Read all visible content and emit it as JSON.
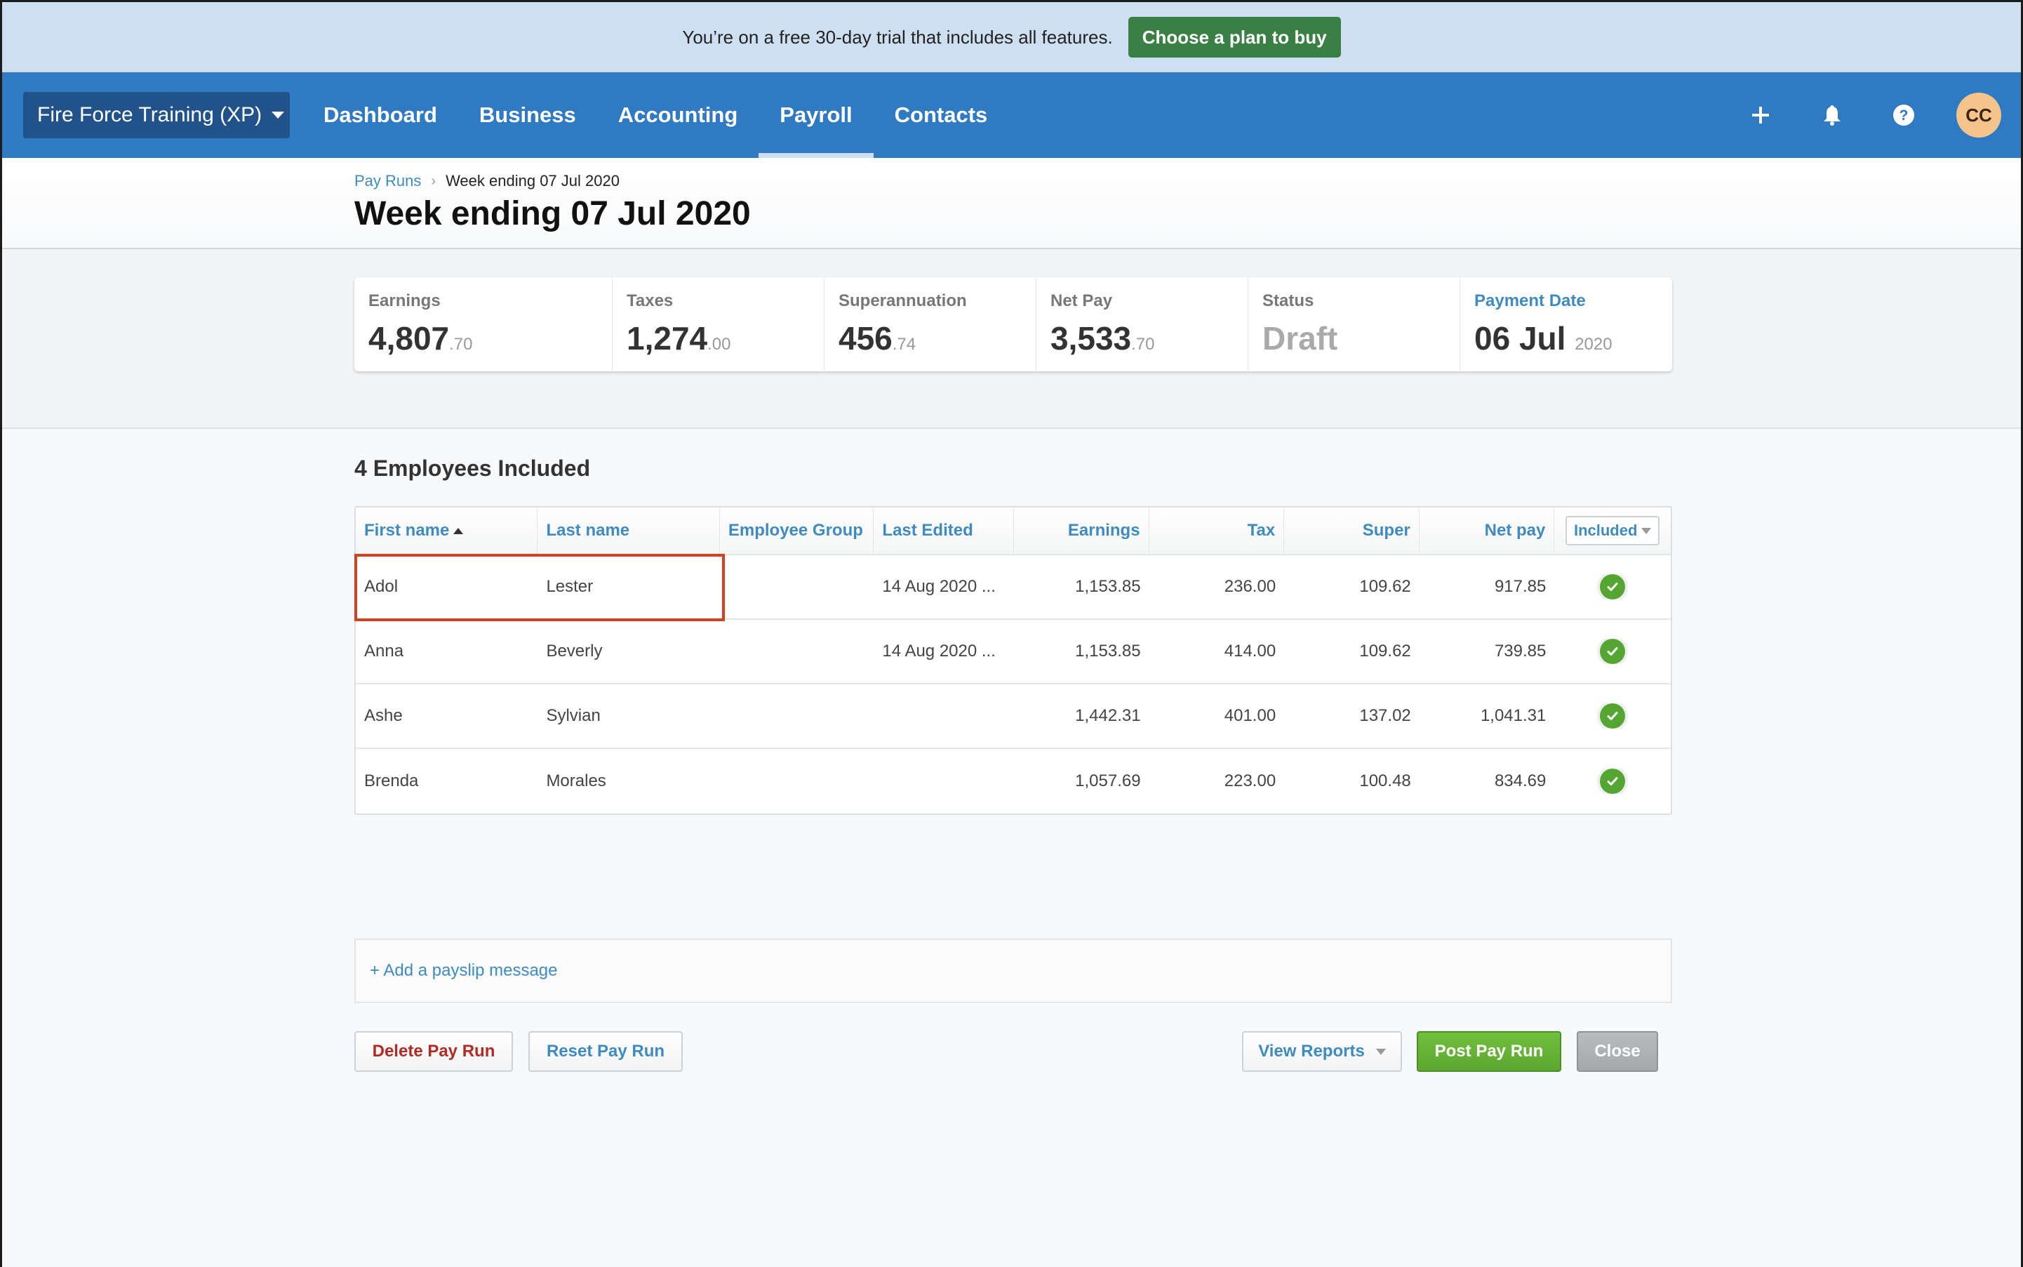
{
  "trial": {
    "message": "You’re on a free 30-day trial that includes all features.",
    "cta_label": "Choose a plan to buy"
  },
  "nav": {
    "org_name": "Fire Force Training (XP)",
    "links": [
      {
        "label": "Dashboard",
        "active": false
      },
      {
        "label": "Business",
        "active": false
      },
      {
        "label": "Accounting",
        "active": false
      },
      {
        "label": "Payroll",
        "active": true
      },
      {
        "label": "Contacts",
        "active": false
      }
    ],
    "icons": [
      "plus-icon",
      "bell-icon",
      "help-icon"
    ],
    "avatar_initials": "CC"
  },
  "page": {
    "breadcrumb": {
      "parent": "Pay Runs",
      "separator": "›",
      "current": "Week ending 07 Jul 2020"
    },
    "title": "Week ending 07 Jul 2020"
  },
  "summary": {
    "earnings": {
      "label": "Earnings",
      "whole": "4,807",
      "decimal": ".70"
    },
    "taxes": {
      "label": "Taxes",
      "whole": "1,274",
      "decimal": ".00"
    },
    "super": {
      "label": "Superannuation",
      "whole": "456",
      "decimal": ".74"
    },
    "net_pay": {
      "label": "Net Pay",
      "whole": "3,533",
      "decimal": ".70"
    },
    "status": {
      "label": "Status",
      "value": "Draft"
    },
    "payment_date": {
      "label": "Payment Date",
      "day_month": "06 Jul",
      "year": "2020"
    }
  },
  "employees": {
    "heading": "4 Employees Included",
    "columns": {
      "first_name": "First name",
      "last_name": "Last name",
      "group": "Employee Group",
      "last_edited": "Last Edited",
      "earnings": "Earnings",
      "tax": "Tax",
      "super": "Super",
      "net_pay": "Net pay",
      "included": "Included"
    },
    "rows": [
      {
        "first": "Adol",
        "last": "Lester",
        "group": "",
        "edited": "14 Aug 2020 ...",
        "earnings": "1,153.85",
        "tax": "236.00",
        "super": "109.62",
        "net": "917.85",
        "included": true
      },
      {
        "first": "Anna",
        "last": "Beverly",
        "group": "",
        "edited": "14 Aug 2020 ...",
        "earnings": "1,153.85",
        "tax": "414.00",
        "super": "109.62",
        "net": "739.85",
        "included": true
      },
      {
        "first": "Ashe",
        "last": "Sylvian",
        "group": "",
        "edited": "",
        "earnings": "1,442.31",
        "tax": "401.00",
        "super": "137.02",
        "net": "1,041.31",
        "included": true
      },
      {
        "first": "Brenda",
        "last": "Morales",
        "group": "",
        "edited": "",
        "earnings": "1,057.69",
        "tax": "223.00",
        "super": "100.48",
        "net": "834.69",
        "included": true
      }
    ]
  },
  "payslip": {
    "add_label": "+ Add a payslip message"
  },
  "actions": {
    "delete": "Delete Pay Run",
    "reset": "Reset Pay Run",
    "view_reports": "View Reports",
    "post": "Post Pay Run",
    "close": "Close"
  }
}
